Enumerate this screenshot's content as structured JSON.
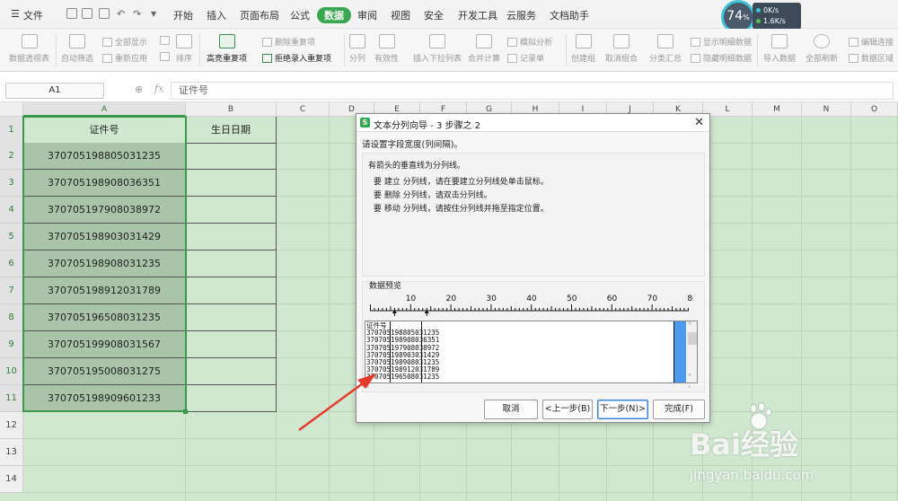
{
  "menubar": {
    "file": "文件",
    "tabs": [
      "开始",
      "插入",
      "页面布局",
      "公式",
      "数据",
      "审阅",
      "视图",
      "安全",
      "开发工具",
      "云服务",
      "文档助手"
    ],
    "active_tab": "数据"
  },
  "ribbon": {
    "pivot": "数据透视表",
    "autofilter": "自动筛选",
    "show_all": "全部显示",
    "reapply": "重新应用",
    "sort": "排序",
    "highlight_dup": "高亮重复项",
    "delete_dup": "删除重复项",
    "reject_dup": "拒绝录入重复项",
    "split": "分列",
    "validity": "有效性",
    "dropdown": "插入下拉列表",
    "consolidate": "合并计算",
    "simulate": "模拟分析",
    "record": "记录单",
    "group": "创建组",
    "ungroup": "取消组合",
    "subtotal": "分类汇总",
    "show_detail": "显示明细数据",
    "hide_detail": "隐藏明细数据",
    "import": "导入数据",
    "refresh": "全部刷新",
    "edit_links": "编辑连接",
    "region": "数据区域"
  },
  "status": {
    "gauge": "74",
    "gauge_unit": "%",
    "net_up": "0K/s",
    "net_down": "1.6K/s",
    "up_color": "#3dc3d6",
    "down_color": "#52c152"
  },
  "formula_bar": {
    "name_box": "A1",
    "fx": "fx",
    "content": "证件号"
  },
  "sheet": {
    "columns": [
      "A",
      "B",
      "C",
      "D",
      "E",
      "F",
      "G",
      "H",
      "I",
      "J",
      "K",
      "L",
      "M",
      "N",
      "O"
    ],
    "rows": [
      "1",
      "2",
      "3",
      "4",
      "5",
      "6",
      "7",
      "8",
      "9",
      "10",
      "11",
      "12",
      "13",
      "14"
    ],
    "header_a": "证件号",
    "header_b": "生日日期",
    "ids": [
      "370705198805031235",
      "370705198908036351",
      "370705197908038972",
      "370705198903031429",
      "370705198908031235",
      "370705198912031789",
      "370705196508031235",
      "370705199908031567",
      "370705195008031275",
      "370705198909601233"
    ]
  },
  "dialog": {
    "title": "文本分列向导 - 3 步骤之 2",
    "prompt": "请设置字段宽度(列间隔)。",
    "info_head": "有箭头的垂直线为分列线。",
    "info_1": "要 建立 分列线，请在要建立分列线处单击鼠标。",
    "info_2": "要 删除 分列线，请双击分列线。",
    "info_3": "要 移动 分列线，请按住分列线并拖至指定位置。",
    "preview_title": "数据预览",
    "ruler": [
      "10",
      "20",
      "30",
      "40",
      "50",
      "60",
      "70",
      "80"
    ],
    "preview_lines": [
      "证件号",
      "370705198805031235",
      "370705198908036351",
      "370705197908038972",
      "370705198903031429",
      "370705198908031235",
      "370705198912031789",
      "370705196508031235"
    ],
    "cancel": "取消",
    "back": "<上一步(B)",
    "next": "下一步(N)>",
    "finish": "完成(F)"
  },
  "watermark": {
    "logo": "Bai经验",
    "url": "jingyan.baidu.com"
  }
}
